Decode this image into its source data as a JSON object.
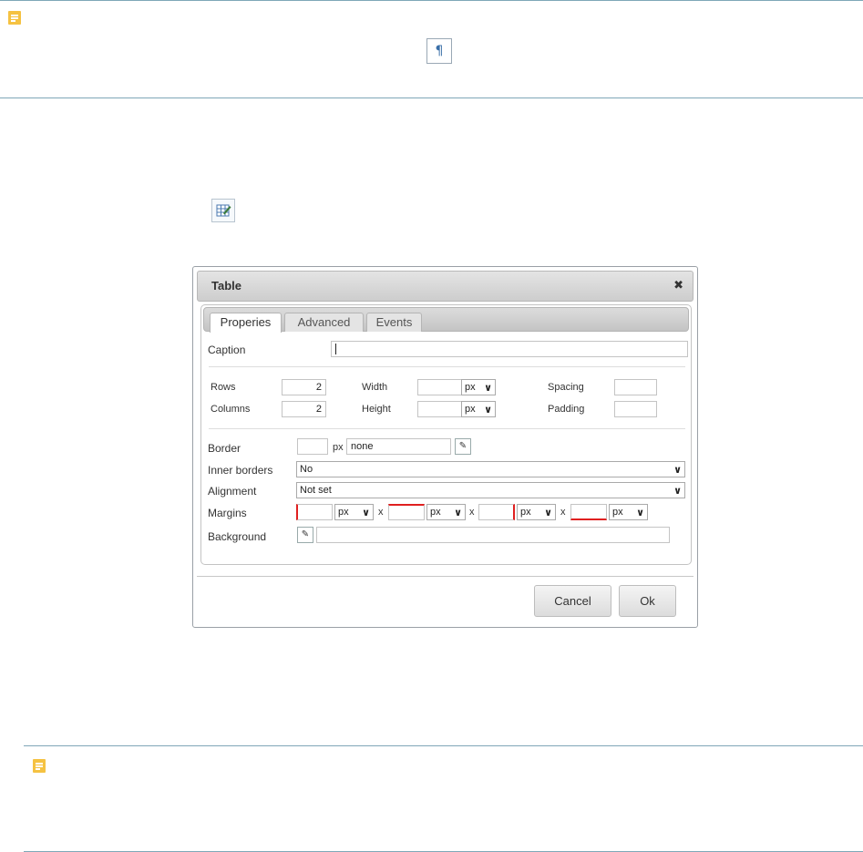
{
  "top_note": {
    "icon": "note-icon",
    "paragraph_icon": "¶"
  },
  "table_button_icon": "table-properties-icon",
  "dialog": {
    "title": "Table",
    "close": "✖",
    "tabs": [
      {
        "label": "Properies",
        "active": true
      },
      {
        "label": "Advanced",
        "active": false
      },
      {
        "label": "Events",
        "active": false
      }
    ],
    "caption": {
      "label": "Caption",
      "value": ""
    },
    "rows": {
      "label": "Rows",
      "value": "2"
    },
    "columns": {
      "label": "Columns",
      "value": "2"
    },
    "width": {
      "label": "Width",
      "value": "",
      "unit": "px"
    },
    "height": {
      "label": "Height",
      "value": "",
      "unit": "px"
    },
    "spacing": {
      "label": "Spacing",
      "value": ""
    },
    "padding": {
      "label": "Padding",
      "value": ""
    },
    "border": {
      "label": "Border",
      "value": "",
      "unit": "px",
      "style": "none"
    },
    "inner_borders": {
      "label": "Inner borders",
      "value": "No"
    },
    "alignment": {
      "label": "Alignment",
      "value": "Not set"
    },
    "margins": {
      "label": "Margins",
      "unit": "px",
      "separator": "x",
      "values": [
        "",
        "",
        "",
        ""
      ]
    },
    "background": {
      "label": "Background",
      "value": ""
    },
    "buttons": {
      "cancel": "Cancel",
      "ok": "Ok"
    }
  },
  "colors": {
    "accent_rule": "#7fa7b8",
    "note": "#f5c242",
    "margin_highlight": "#e02020"
  }
}
